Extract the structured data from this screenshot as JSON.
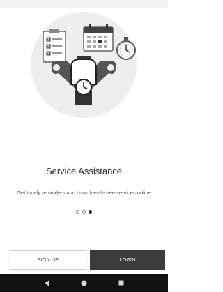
{
  "onboarding": {
    "title": "Service Assistance",
    "subtitle": "Get timely reminders and book hassle free services online",
    "page_indicator": {
      "total": 3,
      "current": 3
    },
    "illustration_icons": [
      "clipboard-icon",
      "calendar-icon",
      "stopwatch-icon",
      "wrench-icon",
      "watch-icon"
    ]
  },
  "actions": {
    "signup_label": "SIGN UP",
    "login_label": "LOGIN"
  },
  "nav": {
    "back_icon": "back-icon",
    "home_icon": "home-icon",
    "recents_icon": "recents-icon"
  },
  "colors": {
    "illustration_circle": "#eeeeee",
    "login_button": "#3c3c3c",
    "nav_bar": "#111111"
  }
}
